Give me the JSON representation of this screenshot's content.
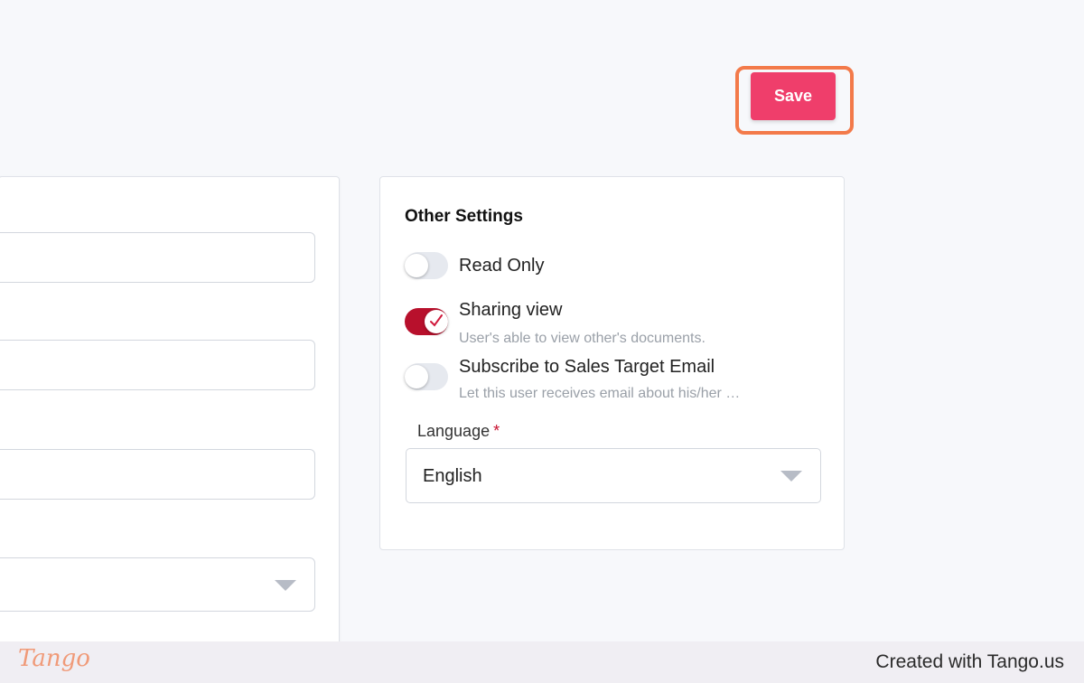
{
  "toolbar": {
    "save_label": "Save"
  },
  "other_settings": {
    "title": "Other Settings",
    "read_only": {
      "label": "Read Only",
      "enabled": false
    },
    "sharing_view": {
      "label": "Sharing view",
      "description": "User's able to view other's documents.",
      "enabled": true
    },
    "sales_target_email": {
      "label": "Subscribe to Sales Target Email",
      "description": "Let this user receives email about his/her sales target",
      "enabled": false
    },
    "language": {
      "label": "Language",
      "required_mark": "*",
      "value": "English"
    }
  },
  "footer": {
    "logo": "Tango",
    "credit": "Created with Tango.us"
  },
  "colors": {
    "accent": "#ef3e6b",
    "toggle_on": "#b8102c",
    "highlight": "#f37a4a"
  },
  "icons": [
    "check-icon",
    "chevron-down-icon"
  ]
}
